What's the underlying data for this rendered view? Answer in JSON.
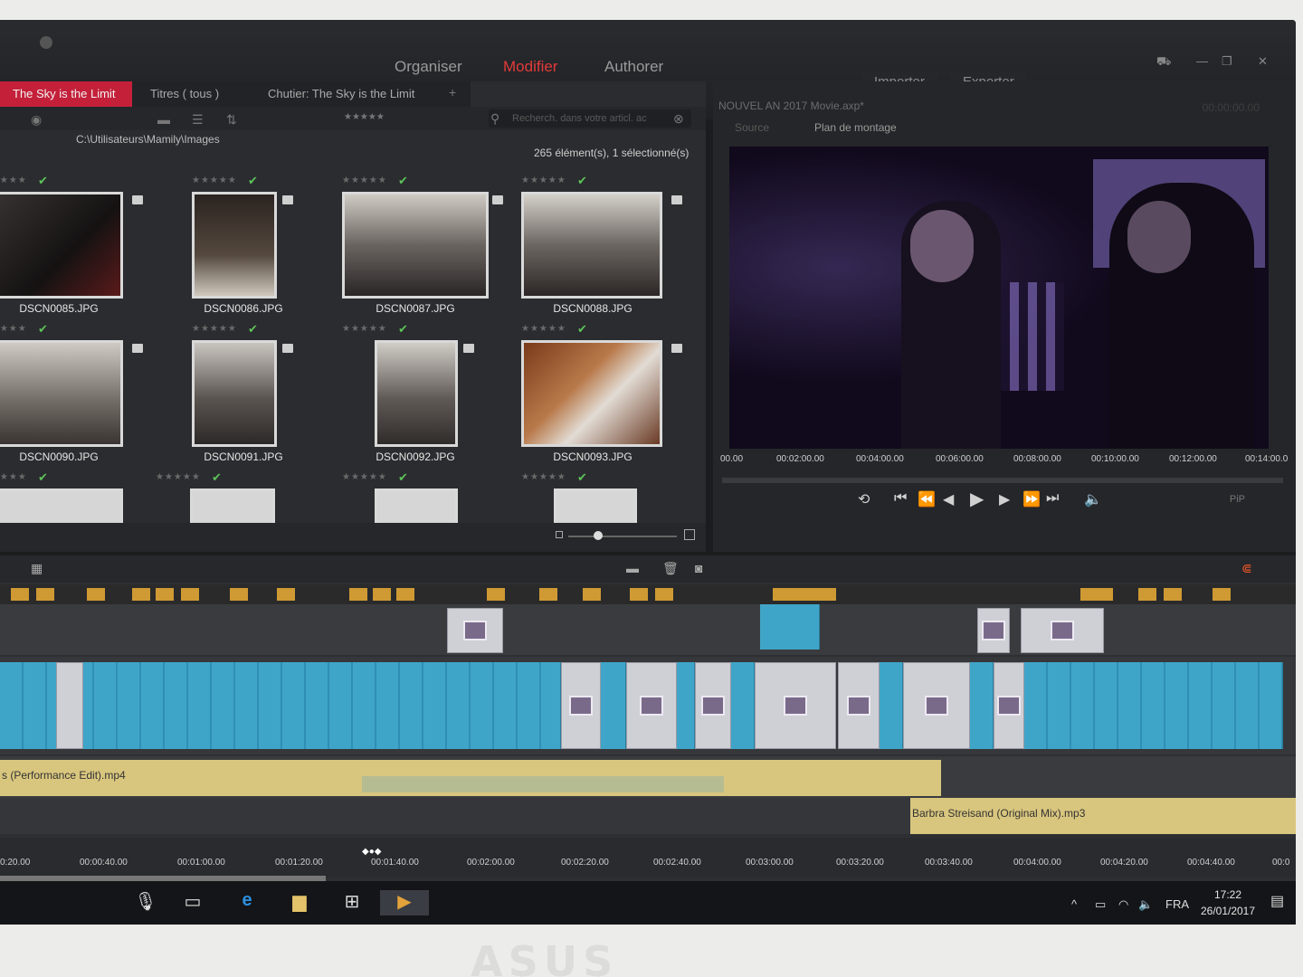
{
  "top": {
    "modes": [
      "Organiser",
      "Modifier",
      "Authorer"
    ],
    "active_mode": "Modifier",
    "import_label": "Importer",
    "export_label": "Exporter"
  },
  "library": {
    "tabs": [
      "The Sky is the Limit",
      "Titres  ( tous )",
      "Chutier: The Sky is the Limit"
    ],
    "search_placeholder": "Recherch. dans votre articl. ac",
    "path": "C:\\Utilisateurs\\Mamily\\Images",
    "count": "265 élément(s), 1 sélectionné(s)",
    "items": [
      {
        "name": "DSCN0085.JPG"
      },
      {
        "name": "DSCN0086.JPG"
      },
      {
        "name": "DSCN0087.JPG"
      },
      {
        "name": "DSCN0088.JPG"
      },
      {
        "name": "DSCN0090.JPG"
      },
      {
        "name": "DSCN0091.JPG"
      },
      {
        "name": "DSCN0092.JPG"
      },
      {
        "name": "DSCN0093.JPG"
      }
    ]
  },
  "player": {
    "project_title": "NOUVEL AN 2017 Movie.axp*",
    "timecode": "00:00:00.00",
    "tab_source": "Source",
    "tab_timeline": "Plan de montage",
    "ruler": [
      "00.00",
      "00:02:00.00",
      "00:04:00.00",
      "00:06:00.00",
      "00:08:00.00",
      "00:10:00.00",
      "00:12:00.00",
      "00:14:00.0"
    ],
    "pip_label": "PiP"
  },
  "timeline": {
    "audio1_label": "s (Performance Edit).mp4",
    "audio2_label": "Barbra Streisand (Original Mix).mp3",
    "ruler": [
      "0:20.00",
      "00:00:40.00",
      "00:01:00.00",
      "00:01:20.00",
      "00:01:40.00",
      "00:02:00.00",
      "00:02:20.00",
      "00:02:40.00",
      "00:03:00.00",
      "00:03:20.00",
      "00:03:40.00",
      "00:04:00.00",
      "00:04:20.00",
      "00:04:40.00",
      "00:0"
    ]
  },
  "taskbar": {
    "lang": "FRA",
    "time": "17:22",
    "date": "26/01/2017"
  },
  "colors": {
    "accent_red": "#c5203a",
    "clip_blue": "#3fa5c8",
    "audio_yellow": "#d9c67e",
    "marker_orange": "#cf9a33"
  },
  "bezel_logo": "ASUS"
}
